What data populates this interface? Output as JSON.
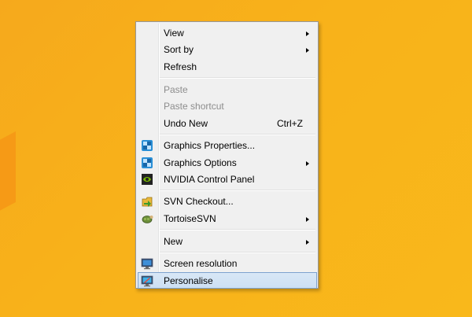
{
  "menu": {
    "items": [
      {
        "label": "View",
        "submenu": true
      },
      {
        "label": "Sort by",
        "submenu": true
      },
      {
        "label": "Refresh"
      },
      {
        "label": "Paste",
        "disabled": true
      },
      {
        "label": "Paste shortcut",
        "disabled": true
      },
      {
        "label": "Undo New",
        "shortcut": "Ctrl+Z"
      },
      {
        "label": "Graphics Properties...",
        "icon": "intel-graphics-icon"
      },
      {
        "label": "Graphics Options",
        "icon": "intel-graphics-icon",
        "submenu": true
      },
      {
        "label": "NVIDIA Control Panel",
        "icon": "nvidia-icon"
      },
      {
        "label": "SVN Checkout...",
        "icon": "svn-checkout-icon"
      },
      {
        "label": "TortoiseSVN",
        "icon": "tortoisesvn-icon",
        "submenu": true
      },
      {
        "label": "New",
        "submenu": true
      },
      {
        "label": "Screen resolution",
        "icon": "monitor-icon"
      },
      {
        "label": "Personalise",
        "icon": "personalise-icon",
        "highlighted": true
      }
    ]
  },
  "colors": {
    "desktop_background": "#f9b21a",
    "menu_background": "#f0f0f0",
    "highlight": "#cde0f3",
    "disabled_text": "#8d8d8d"
  }
}
